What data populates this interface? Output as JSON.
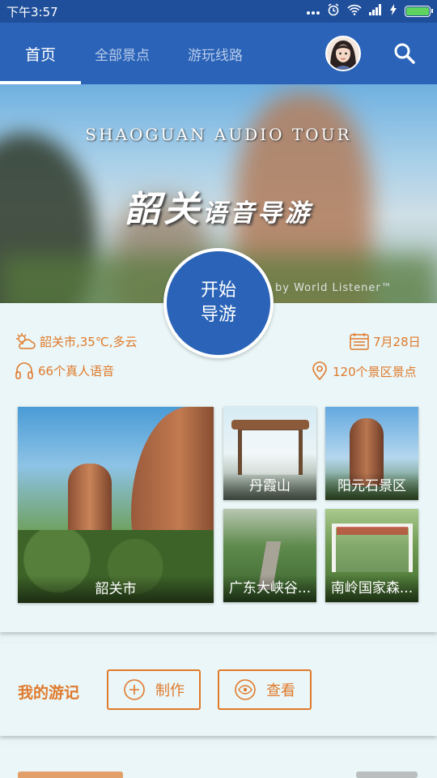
{
  "status_bar": {
    "time": "下午3:57",
    "icons": [
      "more-icon",
      "alarm-icon",
      "wifi-icon",
      "signal-icon",
      "charging-icon",
      "battery-icon"
    ]
  },
  "nav": {
    "tabs": [
      {
        "label": "首页",
        "active": true
      },
      {
        "label": "全部景点",
        "active": false
      },
      {
        "label": "游玩线路",
        "active": false
      }
    ],
    "colors": {
      "header": "#2a63b7",
      "status": "#1f4f9a"
    }
  },
  "banner": {
    "subtitle": "SHAOGUAN AUDIO TOUR",
    "title_main": "韶关",
    "title_rest": "语音导游",
    "credit": "by World Listener™"
  },
  "start_button": {
    "line1": "开始",
    "line2": "导游"
  },
  "info": {
    "weather": "韶关市,35℃,多云",
    "date": "7月28日",
    "voices": "66个真人语音",
    "spots": "120个景区景点"
  },
  "tiles": [
    {
      "name": "韶关市"
    },
    {
      "name": "丹霞山"
    },
    {
      "name": "阳元石景区"
    },
    {
      "name": "广东大峡谷..."
    },
    {
      "name": "南岭国家森..."
    }
  ],
  "journal": {
    "label": "我的游记",
    "make": "制作",
    "view": "查看",
    "accent": "#e07a2c"
  }
}
